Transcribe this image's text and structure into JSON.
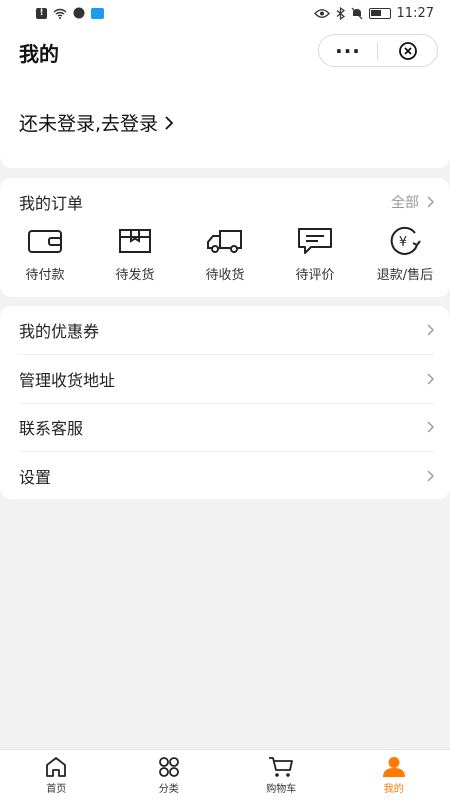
{
  "status_bar": {
    "time": "11:27"
  },
  "header": {
    "title": "我的"
  },
  "login": {
    "text": "还未登录,去登录"
  },
  "orders": {
    "title": "我的订单",
    "all_label": "全部",
    "items": [
      {
        "label": "待付款",
        "icon": "wallet-icon"
      },
      {
        "label": "待发货",
        "icon": "package-icon"
      },
      {
        "label": "待收货",
        "icon": "truck-icon"
      },
      {
        "label": "待评价",
        "icon": "comment-icon"
      },
      {
        "label": "退款/售后",
        "icon": "refund-icon"
      }
    ]
  },
  "menu": {
    "items": [
      {
        "label": "我的优惠券"
      },
      {
        "label": "管理收货地址"
      },
      {
        "label": "联系客服"
      },
      {
        "label": "设置"
      }
    ]
  },
  "tabbar": {
    "items": [
      {
        "label": "首页",
        "icon": "home-icon"
      },
      {
        "label": "分类",
        "icon": "category-icon"
      },
      {
        "label": "购物车",
        "icon": "cart-icon"
      },
      {
        "label": "我的",
        "icon": "user-icon"
      }
    ],
    "active_index": 3
  },
  "colors": {
    "accent": "#ff7a00",
    "background": "#f2f2f2",
    "card": "#ffffff"
  }
}
